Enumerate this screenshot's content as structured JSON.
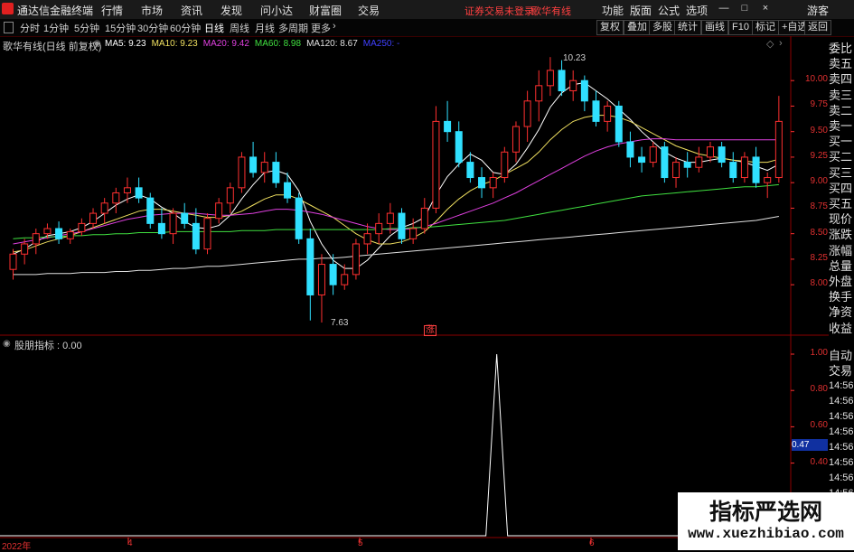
{
  "app": {
    "title": "通达信金融终端",
    "menu": [
      "行情",
      "市场",
      "资讯",
      "发现",
      "问小达",
      "财富圈",
      "交易"
    ],
    "notice": "证券交易未登录",
    "stock_name_top": "歌华有线",
    "right_menu": [
      "功能",
      "版面",
      "公式",
      "选项"
    ],
    "guest": "游客"
  },
  "tabs": [
    "分时",
    "1分钟",
    "5分钟",
    "15分钟",
    "30分钟",
    "60分钟",
    "日线",
    "周线",
    "月线",
    "多周期",
    "更多"
  ],
  "tab_active": "日线",
  "toolbar": [
    "复权",
    "叠加",
    "多股",
    "统计",
    "画线",
    "F10",
    "标记",
    "+自选",
    "返回"
  ],
  "chart_header": {
    "title": "歌华有线(日线 前复权)",
    "ma_labels": [
      {
        "text": "MA5: 9.23",
        "color": "#ffffff"
      },
      {
        "text": "MA10: 9.23",
        "color": "#f0e060"
      },
      {
        "text": "MA20: 9.42",
        "color": "#e040e0"
      },
      {
        "text": "MA60: 8.98",
        "color": "#40e040"
      },
      {
        "text": "MA120: 8.67",
        "color": "#e0e0e0"
      },
      {
        "text": "MA250: -",
        "color": "#4040ff"
      }
    ]
  },
  "price_axis": [
    "10.00",
    "9.75",
    "9.50",
    "9.25",
    "9.00",
    "8.75",
    "8.50",
    "8.25",
    "8.00"
  ],
  "annotations": {
    "high": "10.23",
    "low": "7.63",
    "marker": "涨"
  },
  "right_panel": [
    "委比",
    "卖五",
    "卖四",
    "卖三",
    "卖二",
    "卖一",
    "买一",
    "买二",
    "买三",
    "买四",
    "买五",
    "现价",
    "涨跌",
    "涨幅",
    "总量",
    "外盘",
    "换手",
    "净资",
    "收益"
  ],
  "lower_right_panel": [
    "自动",
    "交易",
    "14:56",
    "14:56",
    "14:56",
    "14:56",
    "14:56",
    "14:56",
    "14:56",
    "14:56",
    "14:56"
  ],
  "indicator": {
    "title": "股朋指标 : 0.00",
    "axis": [
      "1.00",
      "0.80",
      "0.60",
      "0.40"
    ],
    "current": "0.47",
    "spike_value": 1.0
  },
  "x_axis": [
    "2022年",
    "4",
    "5",
    "6"
  ],
  "watermark": {
    "line1": "指标严选网",
    "line2": "www.xuezhibiao.com"
  },
  "colors": {
    "up": "#ff3030",
    "down": "#30e0ff",
    "grid": "#8b0000",
    "axis": "#ff3030"
  },
  "chart_data": {
    "type": "candlestick",
    "candles_ohlc": [
      [
        8.15,
        8.35,
        8.05,
        8.3
      ],
      [
        8.3,
        8.45,
        8.2,
        8.4
      ],
      [
        8.4,
        8.55,
        8.3,
        8.5
      ],
      [
        8.5,
        8.6,
        8.45,
        8.55
      ],
      [
        8.55,
        8.62,
        8.4,
        8.45
      ],
      [
        8.45,
        8.55,
        8.4,
        8.52
      ],
      [
        8.52,
        8.65,
        8.48,
        8.6
      ],
      [
        8.6,
        8.75,
        8.55,
        8.7
      ],
      [
        8.7,
        8.85,
        8.6,
        8.8
      ],
      [
        8.8,
        8.95,
        8.7,
        8.9
      ],
      [
        8.9,
        9.05,
        8.8,
        8.95
      ],
      [
        8.95,
        9.05,
        8.8,
        8.85
      ],
      [
        8.85,
        8.9,
        8.55,
        8.6
      ],
      [
        8.6,
        8.75,
        8.45,
        8.5
      ],
      [
        8.5,
        8.75,
        8.4,
        8.7
      ],
      [
        8.7,
        8.8,
        8.55,
        8.6
      ],
      [
        8.6,
        8.75,
        8.3,
        8.35
      ],
      [
        8.35,
        8.7,
        8.3,
        8.65
      ],
      [
        8.65,
        8.85,
        8.6,
        8.8
      ],
      [
        8.8,
        9.0,
        8.7,
        8.95
      ],
      [
        8.95,
        9.3,
        8.9,
        9.25
      ],
      [
        9.25,
        9.4,
        9.05,
        9.1
      ],
      [
        9.1,
        9.3,
        9.0,
        9.2
      ],
      [
        9.2,
        9.3,
        8.95,
        9.0
      ],
      [
        9.0,
        9.1,
        8.8,
        8.85
      ],
      [
        8.85,
        8.9,
        8.4,
        8.45
      ],
      [
        8.45,
        8.55,
        7.65,
        7.9
      ],
      [
        7.9,
        8.3,
        7.63,
        8.2
      ],
      [
        8.2,
        8.3,
        7.9,
        8.0
      ],
      [
        8.0,
        8.2,
        7.95,
        8.1
      ],
      [
        8.1,
        8.45,
        8.05,
        8.4
      ],
      [
        8.4,
        8.6,
        8.3,
        8.5
      ],
      [
        8.5,
        8.7,
        8.4,
        8.6
      ],
      [
        8.6,
        8.8,
        8.5,
        8.7
      ],
      [
        8.7,
        8.75,
        8.4,
        8.45
      ],
      [
        8.45,
        8.65,
        8.4,
        8.55
      ],
      [
        8.55,
        8.85,
        8.5,
        8.75
      ],
      [
        8.75,
        9.75,
        8.7,
        9.6
      ],
      [
        9.6,
        9.8,
        9.4,
        9.5
      ],
      [
        9.5,
        9.6,
        9.15,
        9.2
      ],
      [
        9.2,
        9.3,
        9.0,
        9.05
      ],
      [
        9.05,
        9.15,
        8.85,
        8.95
      ],
      [
        8.95,
        9.1,
        8.85,
        9.05
      ],
      [
        9.05,
        9.35,
        9.0,
        9.3
      ],
      [
        9.3,
        9.6,
        9.2,
        9.55
      ],
      [
        9.55,
        9.9,
        9.4,
        9.8
      ],
      [
        9.8,
        10.1,
        9.6,
        9.95
      ],
      [
        9.95,
        10.23,
        9.85,
        10.1
      ],
      [
        10.1,
        10.2,
        9.85,
        9.9
      ],
      [
        9.9,
        10.1,
        9.8,
        10.0
      ],
      [
        10.0,
        10.05,
        9.7,
        9.8
      ],
      [
        9.8,
        9.9,
        9.55,
        9.6
      ],
      [
        9.6,
        9.8,
        9.5,
        9.75
      ],
      [
        9.75,
        9.8,
        9.35,
        9.4
      ],
      [
        9.4,
        9.5,
        9.15,
        9.25
      ],
      [
        9.25,
        9.35,
        9.1,
        9.2
      ],
      [
        9.2,
        9.4,
        9.15,
        9.35
      ],
      [
        9.35,
        9.4,
        9.0,
        9.05
      ],
      [
        9.05,
        9.25,
        8.95,
        9.2
      ],
      [
        9.2,
        9.3,
        9.05,
        9.15
      ],
      [
        9.15,
        9.35,
        9.1,
        9.25
      ],
      [
        9.25,
        9.4,
        9.2,
        9.35
      ],
      [
        9.35,
        9.4,
        9.15,
        9.2
      ],
      [
        9.2,
        9.3,
        9.0,
        9.05
      ],
      [
        9.05,
        9.3,
        9.0,
        9.25
      ],
      [
        9.25,
        9.35,
        8.95,
        9.0
      ],
      [
        9.0,
        9.1,
        8.85,
        9.05
      ],
      [
        9.05,
        9.85,
        9.0,
        9.6
      ]
    ],
    "ma_series": [
      {
        "name": "MA5",
        "color": "#ffffff",
        "values": [
          8.3,
          8.35,
          8.42,
          8.48,
          8.5,
          8.52,
          8.56,
          8.62,
          8.7,
          8.78,
          8.84,
          8.88,
          8.84,
          8.76,
          8.7,
          8.62,
          8.56,
          8.55,
          8.58,
          8.68,
          8.84,
          8.98,
          9.1,
          9.12,
          9.08,
          8.92,
          8.62,
          8.4,
          8.24,
          8.16,
          8.16,
          8.24,
          8.36,
          8.48,
          8.56,
          8.6,
          8.66,
          8.88,
          9.06,
          9.18,
          9.28,
          9.22,
          9.1,
          9.08,
          9.18,
          9.34,
          9.52,
          9.74,
          9.88,
          9.96,
          9.98,
          9.9,
          9.82,
          9.72,
          9.62,
          9.5,
          9.4,
          9.3,
          9.24,
          9.2,
          9.2,
          9.22,
          9.24,
          9.22,
          9.2,
          9.16,
          9.12,
          9.18
        ]
      },
      {
        "name": "MA10",
        "color": "#f0e060",
        "values": [
          8.32,
          8.34,
          8.38,
          8.42,
          8.45,
          8.48,
          8.52,
          8.56,
          8.6,
          8.64,
          8.68,
          8.72,
          8.74,
          8.74,
          8.72,
          8.7,
          8.68,
          8.66,
          8.66,
          8.68,
          8.72,
          8.78,
          8.84,
          8.88,
          8.88,
          8.84,
          8.78,
          8.72,
          8.66,
          8.58,
          8.5,
          8.44,
          8.4,
          8.4,
          8.42,
          8.46,
          8.52,
          8.62,
          8.74,
          8.84,
          8.92,
          8.98,
          9.02,
          9.08,
          9.14,
          9.2,
          9.3,
          9.42,
          9.52,
          9.6,
          9.64,
          9.66,
          9.66,
          9.64,
          9.6,
          9.54,
          9.48,
          9.42,
          9.36,
          9.32,
          9.28,
          9.26,
          9.24,
          9.22,
          9.21,
          9.2,
          9.2,
          9.23
        ]
      },
      {
        "name": "MA20",
        "color": "#e040e0",
        "values": [
          8.4,
          8.42,
          8.44,
          8.46,
          8.48,
          8.5,
          8.52,
          8.55,
          8.58,
          8.61,
          8.64,
          8.66,
          8.68,
          8.69,
          8.7,
          8.7,
          8.7,
          8.69,
          8.68,
          8.68,
          8.69,
          8.7,
          8.72,
          8.74,
          8.74,
          8.73,
          8.71,
          8.69,
          8.66,
          8.63,
          8.6,
          8.57,
          8.55,
          8.54,
          8.54,
          8.55,
          8.57,
          8.6,
          8.64,
          8.68,
          8.72,
          8.76,
          8.8,
          8.85,
          8.9,
          8.96,
          9.02,
          9.08,
          9.14,
          9.2,
          9.26,
          9.31,
          9.35,
          9.38,
          9.4,
          9.42,
          9.43,
          9.43,
          9.42,
          9.42,
          9.42,
          9.42,
          9.42,
          9.42,
          9.42,
          9.42,
          9.42,
          9.42
        ]
      },
      {
        "name": "MA60",
        "color": "#40e040",
        "values": [
          8.45,
          8.46,
          8.46,
          8.47,
          8.47,
          8.48,
          8.48,
          8.49,
          8.49,
          8.5,
          8.5,
          8.51,
          8.51,
          8.51,
          8.52,
          8.52,
          8.52,
          8.52,
          8.52,
          8.52,
          8.53,
          8.53,
          8.53,
          8.54,
          8.54,
          8.54,
          8.54,
          8.54,
          8.54,
          8.54,
          8.54,
          8.54,
          8.54,
          8.55,
          8.55,
          8.56,
          8.56,
          8.57,
          8.58,
          8.59,
          8.6,
          8.61,
          8.62,
          8.63,
          8.65,
          8.67,
          8.69,
          8.71,
          8.73,
          8.75,
          8.77,
          8.79,
          8.81,
          8.83,
          8.85,
          8.87,
          8.88,
          8.89,
          8.9,
          8.91,
          8.92,
          8.93,
          8.94,
          8.95,
          8.96,
          8.96,
          8.97,
          8.98
        ]
      },
      {
        "name": "MA120",
        "color": "#e0e0e0",
        "values": [
          8.1,
          8.1,
          8.1,
          8.11,
          8.11,
          8.11,
          8.12,
          8.12,
          8.12,
          8.13,
          8.13,
          8.14,
          8.14,
          8.15,
          8.16,
          8.16,
          8.17,
          8.18,
          8.18,
          8.19,
          8.2,
          8.21,
          8.22,
          8.23,
          8.24,
          8.25,
          8.25,
          8.26,
          8.26,
          8.27,
          8.28,
          8.29,
          8.3,
          8.31,
          8.32,
          8.33,
          8.34,
          8.35,
          8.36,
          8.37,
          8.38,
          8.39,
          8.4,
          8.41,
          8.42,
          8.43,
          8.44,
          8.45,
          8.46,
          8.47,
          8.48,
          8.49,
          8.5,
          8.51,
          8.52,
          8.53,
          8.54,
          8.55,
          8.56,
          8.57,
          8.58,
          8.59,
          8.6,
          8.61,
          8.62,
          8.63,
          8.65,
          8.67
        ]
      }
    ],
    "ylim": [
      7.55,
      10.4
    ],
    "indicator_spike_index": 42
  }
}
